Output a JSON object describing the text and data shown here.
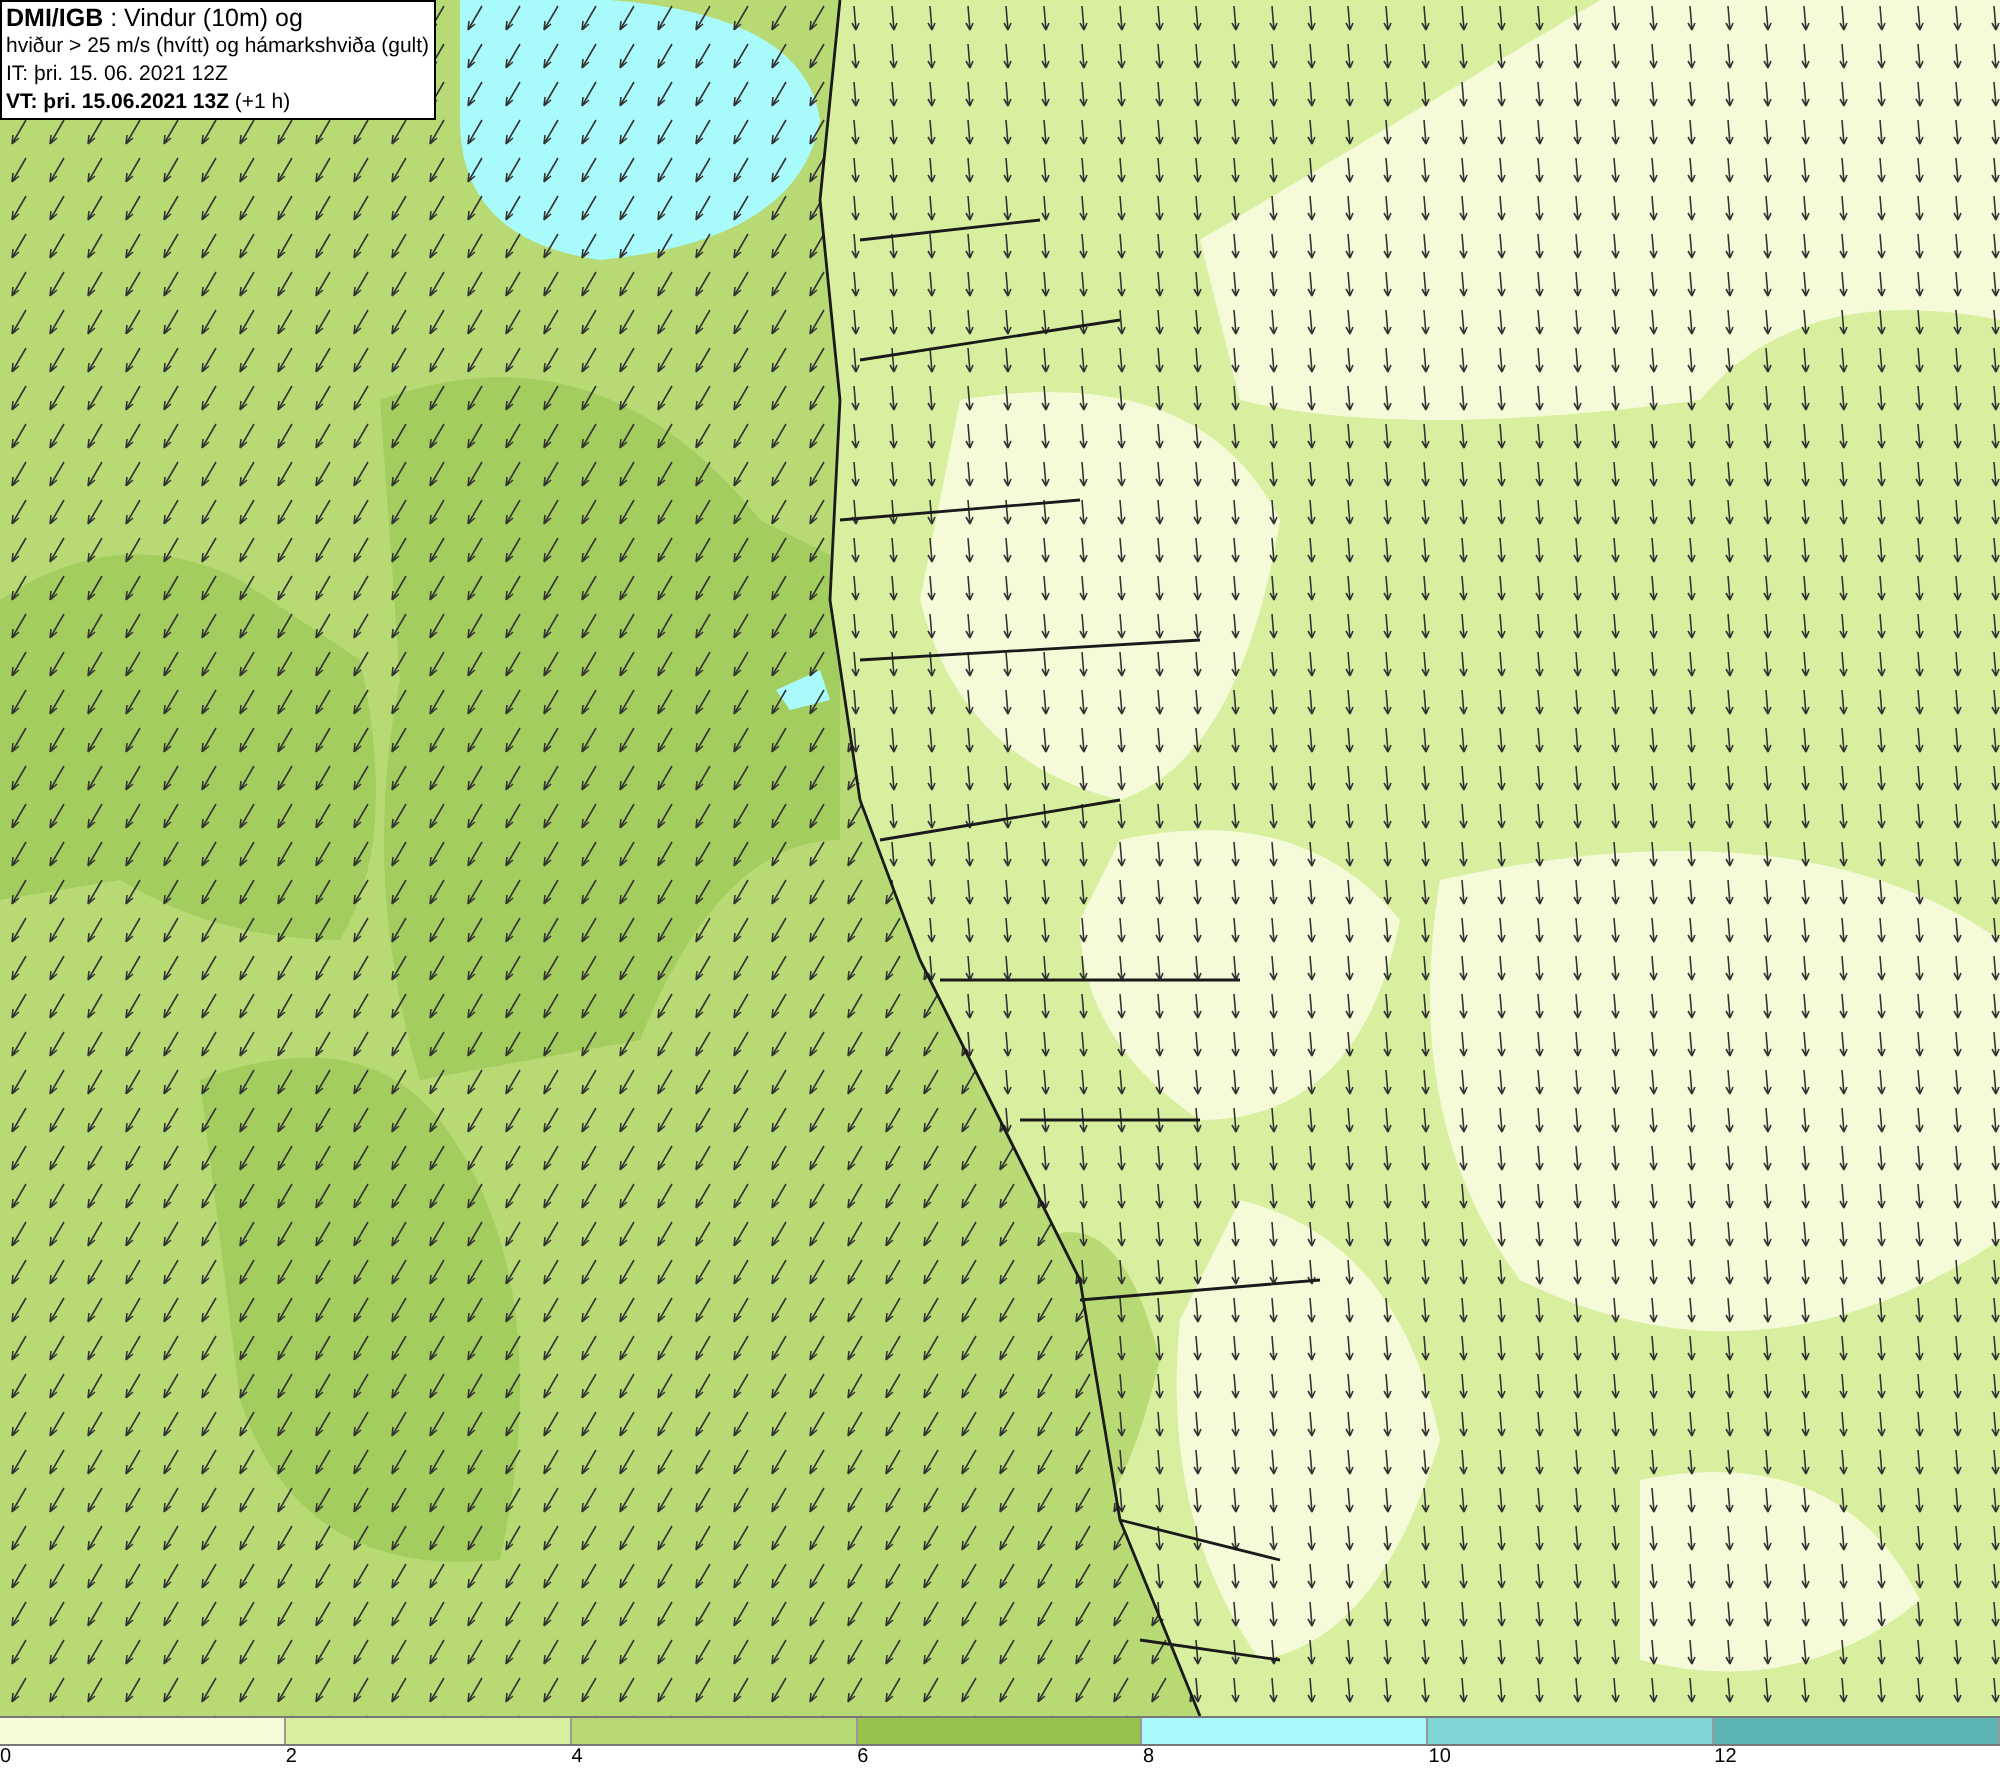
{
  "info_box": {
    "lines": [
      "**DMI/IGB** : Vindur (10m) og",
      "hviður > 25 m/s (hvítt) og hámarkshviða (gult)",
      "IT: þri. 15. 06. 2021 12Z",
      "**VT: þri. 15.06.2021 13Z** (+1 h)"
    ]
  },
  "legend": {
    "bins": [
      {
        "color": "#f5fbd9",
        "label": "0"
      },
      {
        "color": "#d8efa0",
        "label": "2"
      },
      {
        "color": "#b7da74",
        "label": "4"
      },
      {
        "color": "#97c24b",
        "label": "6"
      },
      {
        "color": "#a9fbfb",
        "label": "8"
      },
      {
        "color": "#80d6d6",
        "label": "10"
      },
      {
        "color": "#5cb3b3",
        "label": "12"
      }
    ]
  }
}
